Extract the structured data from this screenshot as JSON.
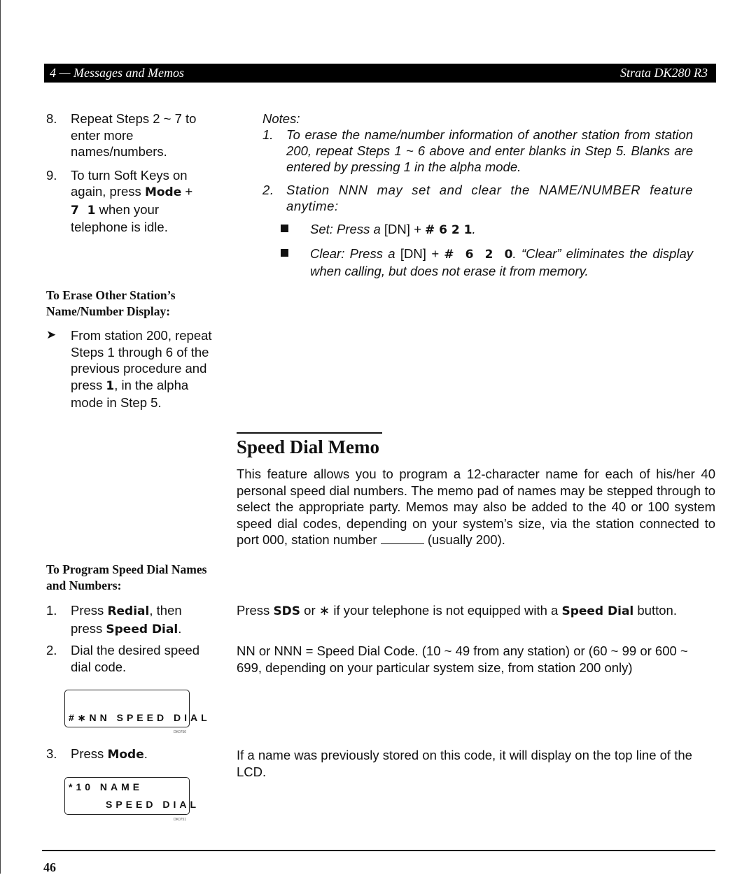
{
  "header": {
    "left": "4 — Messages and Memos",
    "right": "Strata DK280 R3"
  },
  "left_col": {
    "steps_top": [
      {
        "num": "8.",
        "text": "Repeat Steps 2 ~ 7 to enter more names/numbers."
      },
      {
        "num": "9.",
        "pre": "To turn Soft Keys on again, press ",
        "key1": "Mode",
        "mid": " + ",
        "key2": "7  1",
        "post": " when your telephone is idle."
      }
    ],
    "erase_heading": "To Erase Other Station’s Name/Number Display:",
    "erase_bullet_icon": "arrow-bullet-icon",
    "erase_text_pre": "From station 200, repeat Steps 1 through 6 of the previous procedure and press ",
    "erase_key": "1",
    "erase_text_post": ", in the alpha mode in Step 5.",
    "program_heading": "To Program Speed Dial Names and Numbers:",
    "program_steps": [
      {
        "num": "1.",
        "pre": "Press ",
        "key1": "Redial",
        "mid": ", then press ",
        "key2": "Speed Dial",
        "post": "."
      },
      {
        "num": "2.",
        "text": "Dial the desired speed dial code."
      },
      {
        "num": "3.",
        "pre": "Press ",
        "key1": "Mode",
        "post": "."
      }
    ],
    "lcd1": {
      "line1": "",
      "line2": "#∗NN SPEED DIAL",
      "code": "DK0750"
    },
    "lcd2": {
      "line1": "*10 NAME",
      "line2": "SPEED DIAL",
      "code": "DK0751"
    }
  },
  "notes": {
    "label": "Notes:",
    "items": [
      {
        "num": "1.",
        "text": "To erase the name/number information of another station from station 200, repeat Steps 1 ~ 6 above and enter blanks in Step 5. Blanks are entered by pressing 1 in the alpha mode."
      },
      {
        "num": "2.",
        "text": "Station NNN may set and clear the NAME/NUMBER feature anytime:"
      }
    ],
    "bullets": [
      {
        "pre": "Set: Press a ",
        "dn": "[DN]",
        "plus": " + ",
        "key": "# 6 2 1",
        "post": "."
      },
      {
        "pre": "Clear: Press a ",
        "dn": "[DN]",
        "plus": " + ",
        "key": "#  6  2  0",
        "post": ". “Clear” eliminates the display when calling, but does not erase it from memory."
      }
    ]
  },
  "section": {
    "title": "Speed Dial Memo",
    "intro_pre": "This feature allows you to program a 12-character name for each of his/her 40 personal speed dial numbers. The memo pad of names may be stepped through to select the appropriate party. Memos may also be added to the 40 or 100 system speed dial codes, depending on your system’s size, via the station connected to port 000, station number ",
    "intro_post": " (usually 200).",
    "step1_note": {
      "pre": "Press ",
      "key1": "SDS",
      "mid": " or ∗ if your telephone is not equipped with a ",
      "key2": "Speed Dial",
      "post": " button."
    },
    "step2_note": "NN or NNN = Speed Dial Code. (10 ~ 49 from any station) or (60 ~ 99 or 600 ~ 699, depending on your particular system size, from station 200 only)",
    "step3_note": "If a name was previously stored on this code, it will display on the top line of the LCD."
  },
  "footer": {
    "page_number": "46"
  }
}
